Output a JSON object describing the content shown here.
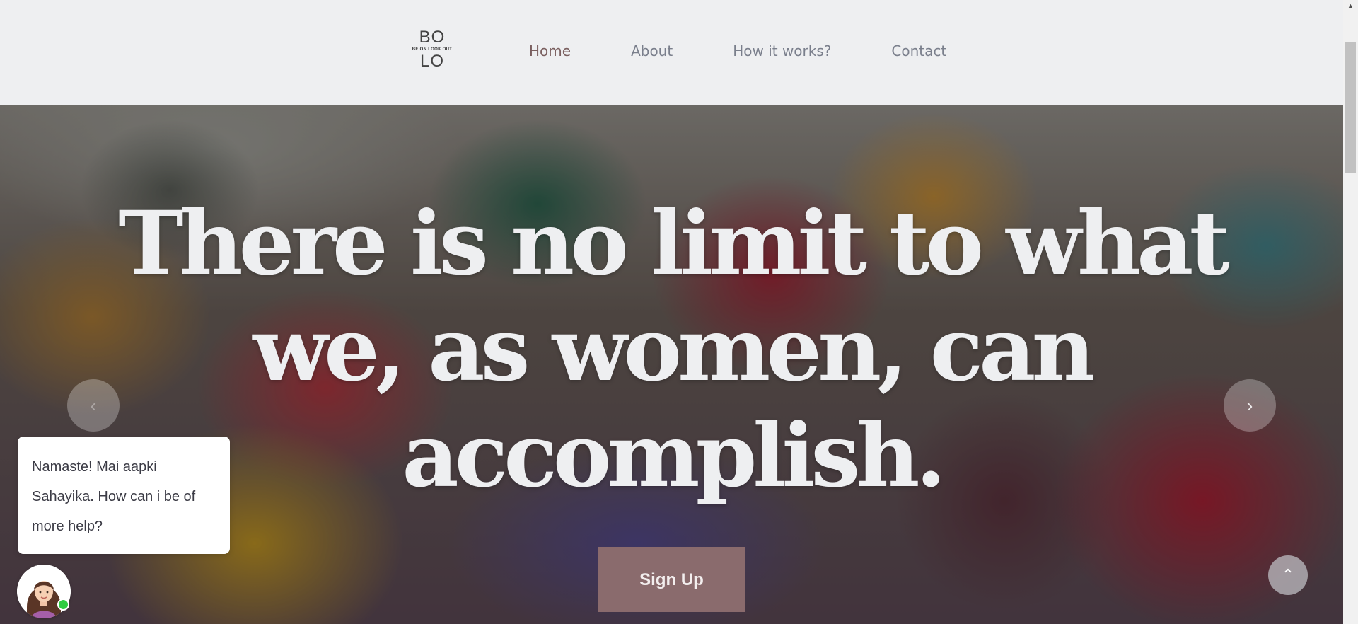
{
  "header": {
    "logo": {
      "line1": "BO",
      "tagline": "BE ON LOOK OUT",
      "line2": "LO"
    },
    "nav": [
      {
        "label": "Home",
        "active": true
      },
      {
        "label": "About",
        "active": false
      },
      {
        "label": "How it works?",
        "active": false
      },
      {
        "label": "Contact",
        "active": false
      }
    ]
  },
  "hero": {
    "headline": "There is no limit to what we, as women, can accomplish.",
    "cta_label": "Sign Up",
    "prev_icon": "‹",
    "next_icon": "›"
  },
  "chat": {
    "message": "Namaste! Mai aapki Sahayika. How can i be of more help?",
    "avatar_icon": "woman-avatar-icon",
    "status_color": "#2ecc40"
  },
  "scroll_top_icon": "⌃",
  "colors": {
    "background": "#eeeff1",
    "nav_text": "#7a7f8c",
    "nav_active": "#7a5f5f",
    "cta_background": "#8a6b6d",
    "headline": "#eeeff1"
  }
}
